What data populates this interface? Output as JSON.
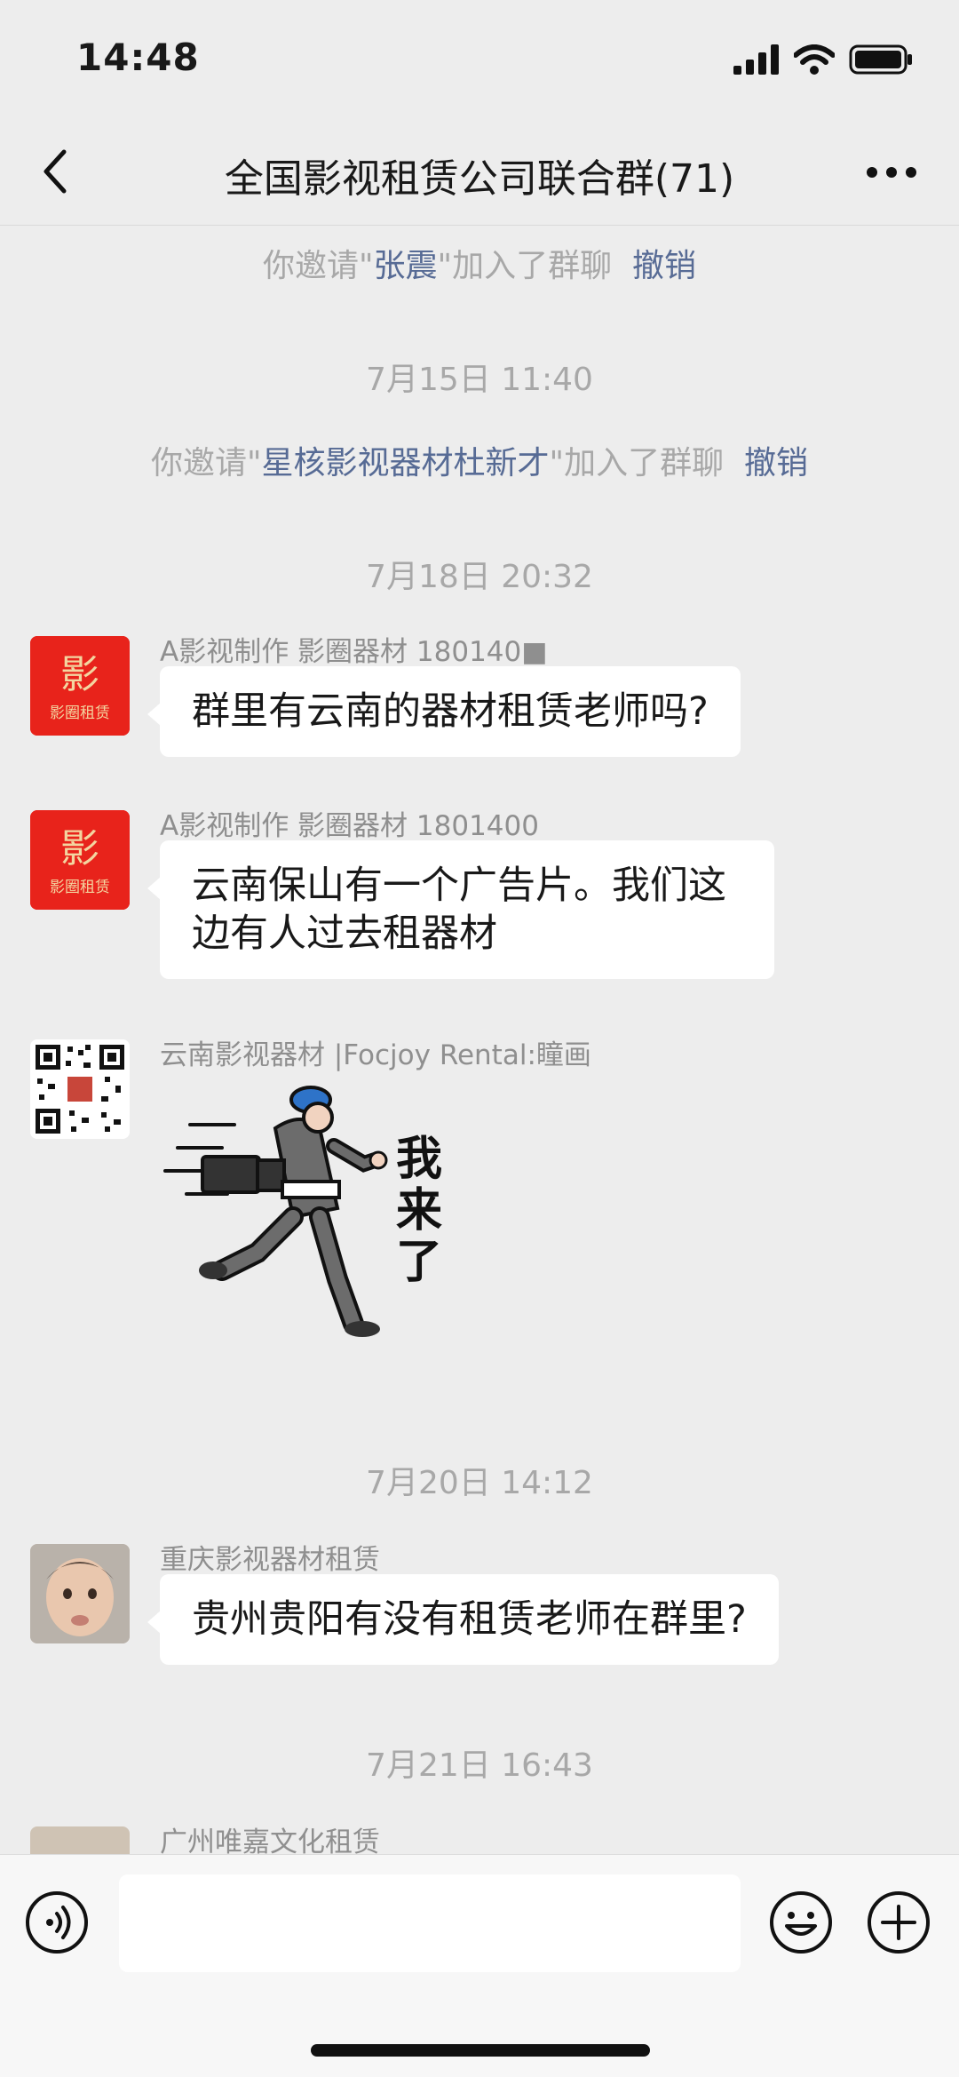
{
  "status_bar": {
    "time": "14:48"
  },
  "nav": {
    "title": "全国影视租赁公司联合群(71)"
  },
  "system_1": {
    "prefix": "你邀请\"",
    "name": "张震",
    "suffix": "\"加入了群聊",
    "action": "撤销"
  },
  "time_1": "7月15日 11:40",
  "system_2": {
    "prefix": "你邀请\"",
    "name": "星核影视器材杜新才",
    "suffix": "\"加入了群聊",
    "action": "撤销"
  },
  "time_2": "7月18日 20:32",
  "messages": [
    {
      "sender": "A影视制作 影圈器材  180140■",
      "text": "群里有云南的器材租赁老师吗?"
    },
    {
      "sender": "A影视制作 影圈器材  1801400",
      "text_line1": "云南保山有一个广告片。我们这",
      "text_line2": "边有人过去租器材"
    },
    {
      "sender": "云南影视器材 |Focjoy Rental:瞳画",
      "sticker_text": "我来了"
    },
    {
      "sender": "重庆影视器材租赁",
      "text": "贵州贵阳有没有租赁老师在群里?"
    },
    {
      "sender": "广州唯嘉文化租赁"
    }
  ],
  "time_3": "7月20日 14:12",
  "time_4": "7月21日 16:43",
  "avatar_logo_text": {
    "top": "影",
    "bottom": "影圈租赁"
  },
  "icons": {
    "back": "chevron-left-icon",
    "more": "more-dots-icon",
    "voice": "voice-icon",
    "emoji": "emoji-icon",
    "plus": "plus-icon"
  },
  "colors": {
    "link": "#576b95",
    "background": "#ededed",
    "bubble": "#ffffff",
    "logo_red": "#e8231b"
  }
}
